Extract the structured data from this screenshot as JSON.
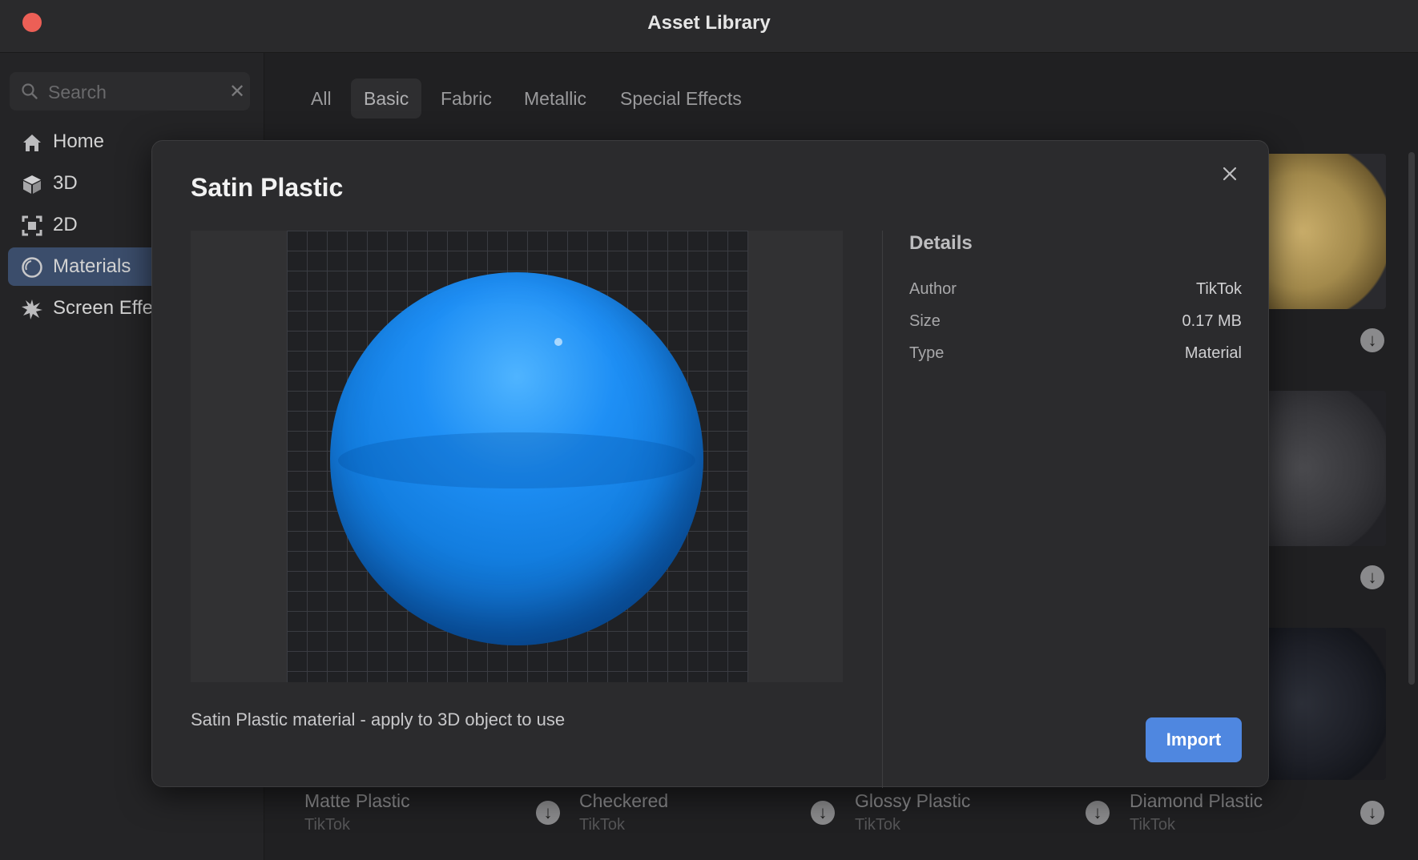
{
  "window": {
    "title": "Asset Library"
  },
  "sidebar": {
    "search_placeholder": "Search",
    "items": [
      {
        "label": "Home",
        "icon": "home-icon"
      },
      {
        "label": "3D",
        "icon": "cube-icon"
      },
      {
        "label": "2D",
        "icon": "frame-icon"
      },
      {
        "label": "Materials",
        "icon": "material-icon",
        "active": true
      },
      {
        "label": "Screen Effe",
        "icon": "sparkle-icon"
      }
    ]
  },
  "tabs": [
    {
      "label": "All"
    },
    {
      "label": "Basic",
      "active": true
    },
    {
      "label": "Fabric"
    },
    {
      "label": "Metallic"
    },
    {
      "label": "Special Effects"
    }
  ],
  "cards": [
    {
      "title": "Matte Plastic",
      "author": "TikTok"
    },
    {
      "title": "Checkered",
      "author": "TikTok"
    },
    {
      "title": "Glossy Plastic",
      "author": "TikTok"
    },
    {
      "title": "Diamond Plastic",
      "author": "TikTok"
    }
  ],
  "modal": {
    "title": "Satin Plastic",
    "description": "Satin Plastic material - apply to 3D object to use",
    "details_heading": "Details",
    "details": [
      {
        "key": "Author",
        "value": "TikTok"
      },
      {
        "key": "Size",
        "value": "0.17 MB"
      },
      {
        "key": "Type",
        "value": "Material"
      }
    ],
    "import_label": "Import"
  },
  "colors": {
    "accent": "#4f87e0",
    "active_nav": "#3b4d6b",
    "close_dot": "#ec5f56"
  }
}
